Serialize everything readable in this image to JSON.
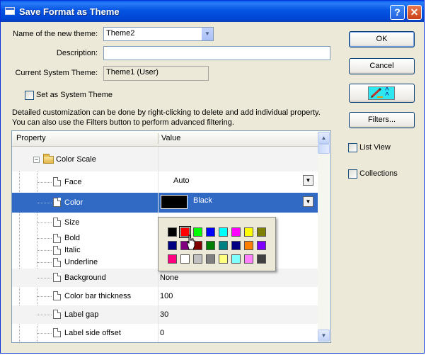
{
  "window": {
    "title": "Save Format as Theme",
    "help_glyph": "?",
    "close_glyph": "✕"
  },
  "form": {
    "theme_name_label": "Name of the new theme:",
    "theme_name_value": "Theme2",
    "description_label": "Description:",
    "description_value": "",
    "current_system_label": "Current System Theme:",
    "current_system_value": "Theme1 (User)",
    "set_system_label": "Set as System Theme",
    "set_system_checked": false,
    "info_text": "Detailed customization can be done by right-clicking to delete and add individual property. You can also use the Filters button to perform advanced filtering."
  },
  "buttons": {
    "ok": "OK",
    "cancel": "Cancel",
    "filters": "Filters...",
    "edit_icon": "pencil-icon",
    "expand_icon": "double-chevron-up-icon"
  },
  "options": {
    "list_view_label": "List View",
    "list_view_checked": false,
    "collections_label": "Collections",
    "collections_checked": false
  },
  "grid": {
    "header_property": "Property",
    "header_value": "Value",
    "group": {
      "label": "Color Scale",
      "expander": "−"
    },
    "rows": [
      {
        "property": "Face",
        "value": "Auto"
      },
      {
        "property": "Color",
        "value": "Black"
      },
      {
        "property": "Size",
        "value": ""
      },
      {
        "property": "Bold",
        "value": ""
      },
      {
        "property": "Italic",
        "value": ""
      },
      {
        "property": "Underline",
        "value": ""
      },
      {
        "property": "Background",
        "value": "None"
      },
      {
        "property": "Color bar thickness",
        "value": "100"
      },
      {
        "property": "Label gap",
        "value": "30"
      },
      {
        "property": "Label side offset",
        "value": "0"
      }
    ]
  },
  "palette": {
    "selected": "#ff0000",
    "colors": [
      "#000000",
      "#ff0000",
      "#00ff00",
      "#0000ff",
      "#00ffff",
      "#ff00ff",
      "#ffff00",
      "#808000",
      "#000080",
      "#800080",
      "#800000",
      "#008000",
      "#008080",
      "#000080",
      "#ff8000",
      "#8000ff",
      "#ff0080",
      "#ffffff",
      "#c0c0c0",
      "#808080",
      "#ffff80",
      "#80ffff",
      "#ff80ff",
      "#404040"
    ]
  }
}
